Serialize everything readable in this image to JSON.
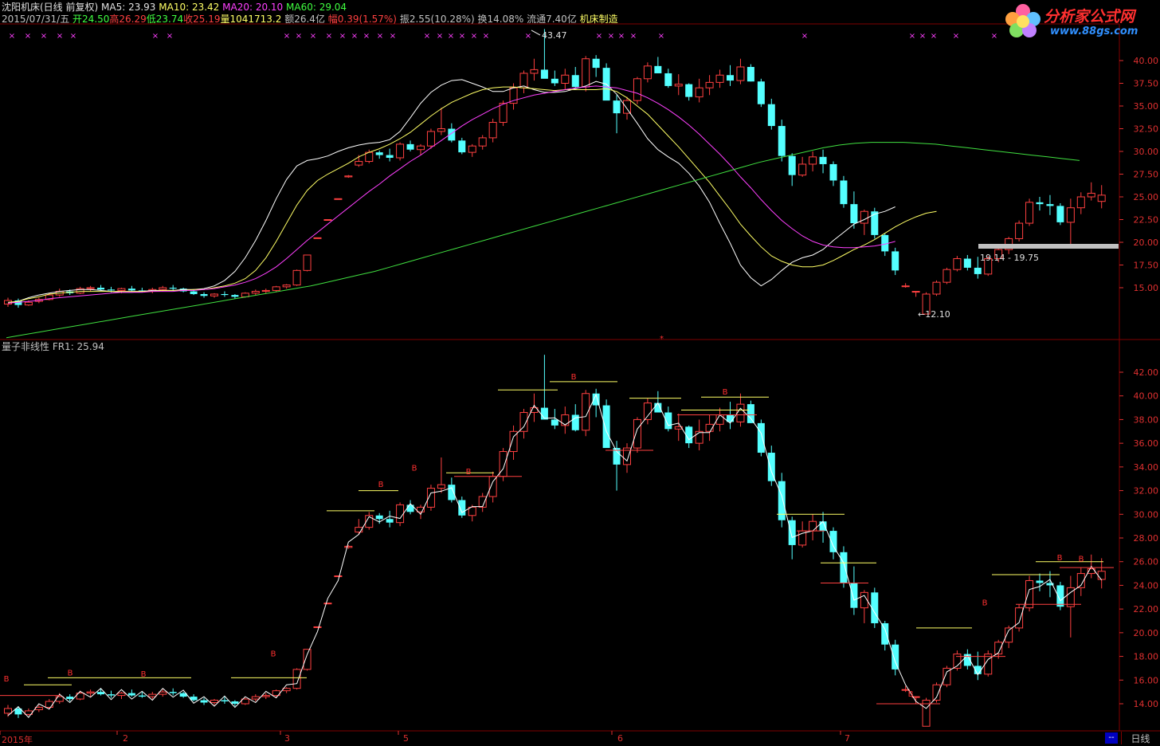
{
  "header": {
    "stock_name": "沈阳机床(日线 前复权)",
    "ma5": "MA5: 23.93",
    "ma10": "MA10: 23.42",
    "ma20": "MA20: 20.10",
    "ma60": "MA60: 29.04",
    "date": "2015/07/31/五",
    "open": "开24.50",
    "high": "高26.29",
    "low": "低23.74",
    "close": "收25.19",
    "volume": "量1041713.2",
    "amount": "额26.4亿",
    "change": "幅0.39(1.57%)",
    "amplitude": "振2.55(10.28%)",
    "turnover": "换14.08%",
    "float_cap": "流通7.40亿",
    "industry": "机床制造"
  },
  "logo": {
    "name": "分析家公式网",
    "url": "www.88gs.com"
  },
  "annotations": {
    "high_mark": "43.47",
    "low_mark": "12.10",
    "range_mark": "19.14 - 19.75"
  },
  "indicator": {
    "title": "量子非线性  FR1: 25.94"
  },
  "x_axis": [
    "2015年",
    "2",
    "3",
    "5",
    "6",
    "7"
  ],
  "tabs": {
    "daily": "日线",
    "scroll": "--"
  },
  "colors": {
    "up": "#ff4040",
    "down": "#54ffff",
    "ma5": "#ffffff",
    "ma10": "#ffff66",
    "ma20": "#ff40ff",
    "ma60": "#40e040",
    "grid": "#800000"
  },
  "chart_data": [
    {
      "type": "candlestick",
      "title": "沈阳机床(日线 前复权)",
      "ylim": [
        11,
        41
      ],
      "y_ticks": [
        "15.00",
        "17.50",
        "20.00",
        "22.50",
        "25.00",
        "27.50",
        "30.00",
        "32.50",
        "35.00",
        "37.50",
        "40.00"
      ],
      "series": [
        {
          "name": "MA5",
          "values": [
            13.3,
            13.5,
            13.9,
            14.2,
            14.4,
            14.6,
            14.7,
            14.8,
            14.8,
            14.7,
            14.6,
            14.5,
            14.5,
            14.6,
            14.7,
            14.7,
            14.7,
            14.8,
            14.8,
            14.9,
            15.2,
            15.8,
            16.8,
            18.3,
            20.2,
            22.4,
            24.8,
            26.9,
            28.4,
            29.0,
            29.2,
            29.5,
            30.0,
            30.4,
            30.7,
            30.9,
            31.0,
            31.3,
            32.2,
            33.7,
            35.3,
            36.5,
            37.3,
            37.8,
            37.9,
            37.5,
            37.1,
            36.6,
            36.6,
            37.0,
            37.2,
            36.8,
            36.5,
            36.5,
            36.6,
            36.9,
            37.2,
            37.7,
            37.4,
            36.3,
            34.7,
            33.1,
            31.4,
            30.2,
            29.4,
            28.7,
            27.6,
            26.2,
            24.4,
            22.1,
            19.9,
            17.5,
            16.1,
            15.2,
            15.9,
            16.9,
            17.8,
            18.3,
            18.6,
            19.2,
            20.2,
            21.1,
            22.0,
            22.5,
            23.1,
            23.4,
            23.9
          ]
        },
        {
          "name": "MA10",
          "values": [
            13.4,
            13.5,
            13.8,
            14.0,
            14.3,
            14.4,
            14.5,
            14.6,
            14.6,
            14.6,
            14.6,
            14.6,
            14.6,
            14.6,
            14.6,
            14.7,
            14.7,
            14.7,
            14.8,
            14.8,
            15.0,
            15.2,
            15.5,
            16.0,
            16.9,
            18.3,
            20.1,
            22.1,
            24.1,
            25.7,
            26.8,
            27.5,
            28.1,
            28.7,
            29.4,
            29.9,
            30.3,
            30.8,
            31.4,
            32.1,
            33.0,
            33.9,
            34.7,
            35.4,
            35.9,
            36.4,
            36.8,
            37.0,
            37.1,
            37.1,
            37.0,
            36.9,
            36.8,
            36.7,
            36.8,
            36.8,
            36.8,
            36.8,
            36.9,
            36.6,
            35.9,
            35.0,
            34.1,
            32.9,
            31.7,
            30.5,
            29.2,
            27.9,
            26.6,
            25.1,
            23.6,
            22.0,
            20.7,
            19.5,
            18.5,
            17.9,
            17.5,
            17.3,
            17.3,
            17.5,
            18.0,
            18.6,
            19.2,
            19.7,
            20.3,
            21.0,
            21.7,
            22.3,
            22.8,
            23.2,
            23.4
          ]
        },
        {
          "name": "MA20",
          "values": [
            13.3,
            13.4,
            13.5,
            13.6,
            13.8,
            13.9,
            14.0,
            14.1,
            14.2,
            14.3,
            14.4,
            14.5,
            14.5,
            14.5,
            14.6,
            14.6,
            14.6,
            14.7,
            14.7,
            14.8,
            14.9,
            15.1,
            15.3,
            15.6,
            16.0,
            16.6,
            17.3,
            18.2,
            19.2,
            20.2,
            21.1,
            22.0,
            22.9,
            23.8,
            24.7,
            25.6,
            26.4,
            27.3,
            28.1,
            28.9,
            29.6,
            30.4,
            31.2,
            32.0,
            32.8,
            33.5,
            34.1,
            34.7,
            35.2,
            35.6,
            35.9,
            36.2,
            36.4,
            36.6,
            36.8,
            37.0,
            37.1,
            37.2,
            37.1,
            37.0,
            36.7,
            36.4,
            35.9,
            35.3,
            34.6,
            33.8,
            32.9,
            31.9,
            30.8,
            29.7,
            28.5,
            27.2,
            26.0,
            24.7,
            23.5,
            22.4,
            21.5,
            20.7,
            20.1,
            19.7,
            19.5,
            19.4,
            19.4,
            19.5,
            19.6,
            19.8,
            20.1
          ]
        },
        {
          "name": "MA60",
          "values": [
            9.5,
            9.8,
            10.1,
            10.4,
            10.7,
            11.0,
            11.3,
            11.6,
            11.9,
            12.2,
            12.5,
            12.8,
            13.1,
            13.4,
            13.7,
            14.0,
            14.3,
            14.6,
            14.9,
            15.2,
            15.6,
            16.0,
            16.4,
            16.8,
            17.3,
            17.8,
            18.3,
            18.8,
            19.3,
            19.8,
            20.3,
            20.8,
            21.3,
            21.8,
            22.3,
            22.8,
            23.3,
            23.8,
            24.3,
            24.8,
            25.3,
            25.8,
            26.3,
            26.8,
            27.3,
            27.8,
            28.3,
            28.8,
            29.2,
            29.6,
            30.0,
            30.4,
            30.7,
            30.9,
            31.0,
            31.0,
            31.0,
            30.9,
            30.8,
            30.6,
            30.4,
            30.2,
            30.0,
            29.8,
            29.6,
            29.4,
            29.2,
            29.0
          ]
        }
      ],
      "candles": [
        [
          13.2,
          13.9,
          12.9,
          13.6
        ],
        [
          13.6,
          13.8,
          12.8,
          13.1
        ],
        [
          13.1,
          13.6,
          13.0,
          13.4
        ],
        [
          13.5,
          13.9,
          13.3,
          13.7
        ],
        [
          13.7,
          14.4,
          13.6,
          14.2
        ],
        [
          14.2,
          14.9,
          14.0,
          14.6
        ],
        [
          14.6,
          14.8,
          14.2,
          14.4
        ],
        [
          14.4,
          15.1,
          14.3,
          14.9
        ],
        [
          14.9,
          15.2,
          14.6,
          15.0
        ],
        [
          15.0,
          15.3,
          14.7,
          14.8
        ],
        [
          14.8,
          15.1,
          14.5,
          14.7
        ],
        [
          14.7,
          15.0,
          14.4,
          14.9
        ],
        [
          14.9,
          15.2,
          14.6,
          14.7
        ],
        [
          14.7,
          15.0,
          14.5,
          14.6
        ],
        [
          14.6,
          15.0,
          14.4,
          14.8
        ],
        [
          14.8,
          15.2,
          14.6,
          15.0
        ],
        [
          15.0,
          15.3,
          14.7,
          14.9
        ],
        [
          14.9,
          15.0,
          14.5,
          14.6
        ],
        [
          14.6,
          14.8,
          14.2,
          14.3
        ],
        [
          14.3,
          14.5,
          13.9,
          14.1
        ],
        [
          14.1,
          14.4,
          13.9,
          14.3
        ],
        [
          14.3,
          14.6,
          14.0,
          14.2
        ],
        [
          14.2,
          14.3,
          13.8,
          14.0
        ],
        [
          14.0,
          14.5,
          13.9,
          14.4
        ],
        [
          14.4,
          14.8,
          14.2,
          14.6
        ],
        [
          14.6,
          14.9,
          14.4,
          14.7
        ],
        [
          14.7,
          15.2,
          14.5,
          15.1
        ],
        [
          15.1,
          15.4,
          14.9,
          15.3
        ],
        [
          15.3,
          17.0,
          15.2,
          16.9
        ],
        [
          16.9,
          18.6,
          16.8,
          18.6
        ],
        [
          20.5,
          20.5,
          20.5,
          20.5
        ],
        [
          22.5,
          22.5,
          22.5,
          22.5
        ],
        [
          24.8,
          24.8,
          24.8,
          24.8
        ],
        [
          27.2,
          27.4,
          27.1,
          27.3
        ],
        [
          28.5,
          29.6,
          28.3,
          28.9
        ],
        [
          28.9,
          30.2,
          28.7,
          29.9
        ],
        [
          29.9,
          30.1,
          29.2,
          29.6
        ],
        [
          29.6,
          30.3,
          28.9,
          29.3
        ],
        [
          29.3,
          31.0,
          29.0,
          30.8
        ],
        [
          30.8,
          31.2,
          30.0,
          30.2
        ],
        [
          30.2,
          30.8,
          29.6,
          30.6
        ],
        [
          30.6,
          32.5,
          30.3,
          32.2
        ],
        [
          32.2,
          34.8,
          31.8,
          32.5
        ],
        [
          32.5,
          33.1,
          31.0,
          31.2
        ],
        [
          31.2,
          31.5,
          29.7,
          29.9
        ],
        [
          29.9,
          30.8,
          29.4,
          30.6
        ],
        [
          30.6,
          31.8,
          30.2,
          31.5
        ],
        [
          31.5,
          33.6,
          31.0,
          33.2
        ],
        [
          33.2,
          35.6,
          32.8,
          35.3
        ],
        [
          35.3,
          37.5,
          34.6,
          37.0
        ],
        [
          37.0,
          38.9,
          36.4,
          38.6
        ],
        [
          38.6,
          40.2,
          37.8,
          39.0
        ],
        [
          39.0,
          43.47,
          38.5,
          38.0
        ],
        [
          38.0,
          38.9,
          37.2,
          37.5
        ],
        [
          37.5,
          39.1,
          36.8,
          38.4
        ],
        [
          38.4,
          39.3,
          37.0,
          37.1
        ],
        [
          37.1,
          40.5,
          36.6,
          40.2
        ],
        [
          40.2,
          40.6,
          38.2,
          39.2
        ],
        [
          39.2,
          39.7,
          36.5,
          35.6
        ],
        [
          35.6,
          36.2,
          32.0,
          34.2
        ],
        [
          34.2,
          36.0,
          33.5,
          35.6
        ],
        [
          35.6,
          38.2,
          35.2,
          38.0
        ],
        [
          38.0,
          39.8,
          37.6,
          39.4
        ],
        [
          39.4,
          40.4,
          38.6,
          38.6
        ],
        [
          38.6,
          39.1,
          37.0,
          37.2
        ],
        [
          37.2,
          38.5,
          36.2,
          37.4
        ],
        [
          37.4,
          37.5,
          35.6,
          36.0
        ],
        [
          36.0,
          38.0,
          35.4,
          37.0
        ],
        [
          37.0,
          38.4,
          36.2,
          37.6
        ],
        [
          37.6,
          39.0,
          37.0,
          38.4
        ],
        [
          38.4,
          39.5,
          37.2,
          37.8
        ],
        [
          37.8,
          40.2,
          37.4,
          39.3
        ],
        [
          39.3,
          39.6,
          37.7,
          37.7
        ],
        [
          37.7,
          38.0,
          34.9,
          35.2
        ],
        [
          35.2,
          35.8,
          32.4,
          32.8
        ],
        [
          32.8,
          33.5,
          28.9,
          29.5
        ],
        [
          29.5,
          29.8,
          26.2,
          27.4
        ],
        [
          27.4,
          29.4,
          27.2,
          28.6
        ],
        [
          28.6,
          30.0,
          27.8,
          29.4
        ],
        [
          29.4,
          30.2,
          27.6,
          28.6
        ],
        [
          28.6,
          28.9,
          26.2,
          26.8
        ],
        [
          26.8,
          27.3,
          23.8,
          24.2
        ],
        [
          24.2,
          25.6,
          21.5,
          22.1
        ],
        [
          22.1,
          23.6,
          20.8,
          23.4
        ],
        [
          23.4,
          23.8,
          20.4,
          20.8
        ],
        [
          20.8,
          21.0,
          18.5,
          19.0
        ],
        [
          19.0,
          19.4,
          16.4,
          16.9
        ],
        [
          15.2,
          15.5,
          15.0,
          15.2
        ],
        [
          14.6,
          14.6,
          14.0,
          14.6
        ],
        [
          12.1,
          14.5,
          12.1,
          14.3
        ],
        [
          14.3,
          15.8,
          14.1,
          15.6
        ],
        [
          15.6,
          17.2,
          15.4,
          17.0
        ],
        [
          17.0,
          18.5,
          16.8,
          18.2
        ],
        [
          18.2,
          18.6,
          16.9,
          17.2
        ],
        [
          17.2,
          18.4,
          16.0,
          16.5
        ],
        [
          16.5,
          18.5,
          16.3,
          18.2
        ],
        [
          18.2,
          19.4,
          17.8,
          19.2
        ],
        [
          19.2,
          20.6,
          18.7,
          20.4
        ],
        [
          20.4,
          22.4,
          20.1,
          22.1
        ],
        [
          22.1,
          24.8,
          21.8,
          24.4
        ],
        [
          24.4,
          25.0,
          23.5,
          24.2
        ],
        [
          24.2,
          25.2,
          23.0,
          24.0
        ],
        [
          24.0,
          24.3,
          21.9,
          22.2
        ],
        [
          22.2,
          24.8,
          19.6,
          23.8
        ],
        [
          23.8,
          25.5,
          23.1,
          25.0
        ],
        [
          25.0,
          26.6,
          24.6,
          25.4
        ],
        [
          24.5,
          26.29,
          23.74,
          25.19
        ]
      ]
    },
    {
      "type": "candlestick",
      "title": "量子非线性  FR1: 25.94",
      "ylim": [
        13,
        43.5
      ],
      "y_ticks": [
        "14.00",
        "16.00",
        "18.00",
        "20.00",
        "22.00",
        "24.00",
        "26.00",
        "28.00",
        "30.00",
        "32.00",
        "34.00",
        "36.00",
        "38.00",
        "40.00",
        "42.00"
      ]
    }
  ]
}
